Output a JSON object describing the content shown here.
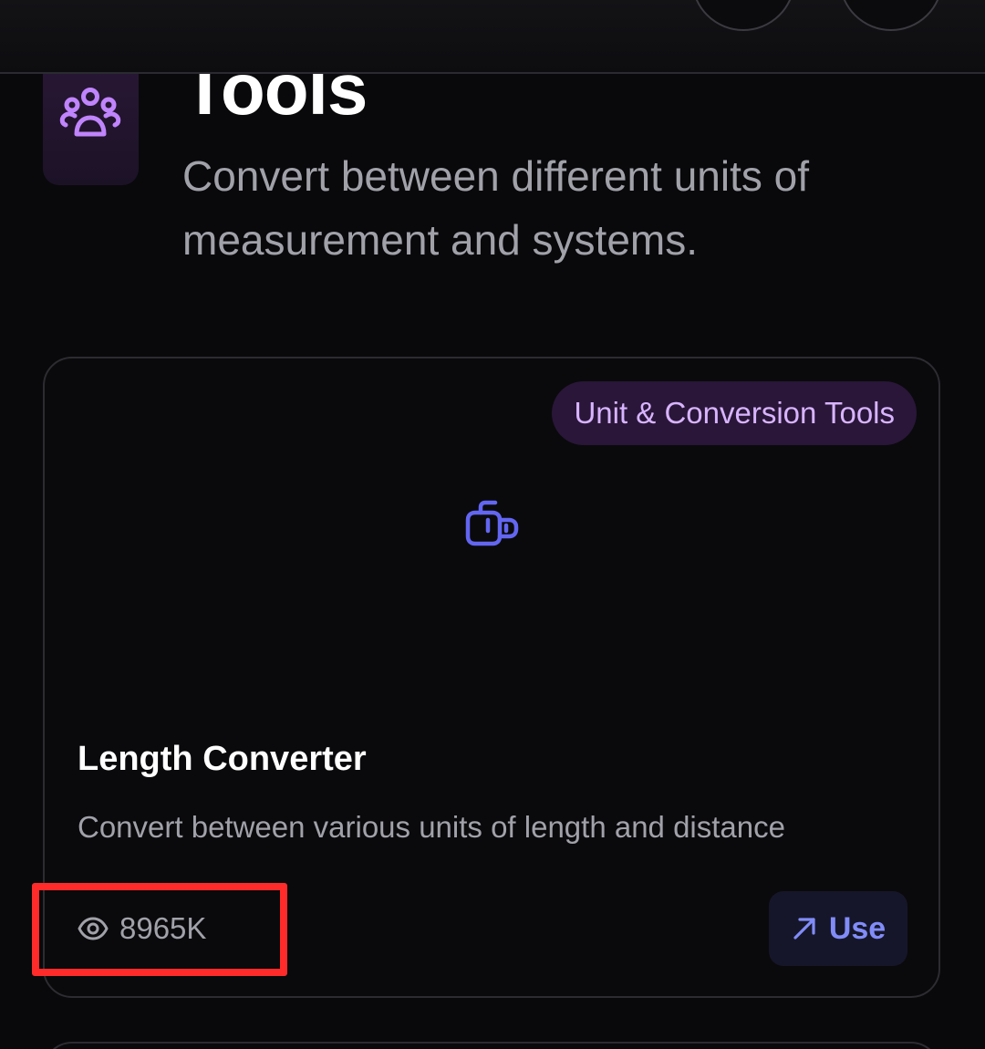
{
  "header": {
    "title": "Tools",
    "subtitle": "Convert between different units of measurement and systems.",
    "icon": "users-group-icon"
  },
  "tool_card": {
    "category": "Unit & Conversion Tools",
    "icon": "convert-icon",
    "title": "Length Converter",
    "description": "Convert between various units of length and distance",
    "views": "8965K",
    "views_icon": "eye-icon",
    "use_label": "Use",
    "use_icon": "arrow-up-right-icon"
  },
  "colors": {
    "background": "#09090b",
    "accent_purple": "#c084fc",
    "accent_indigo": "#818cf8",
    "badge_bg": "#2a1639",
    "muted_text": "#a1a1aa",
    "highlight": "#ff2b2b"
  }
}
